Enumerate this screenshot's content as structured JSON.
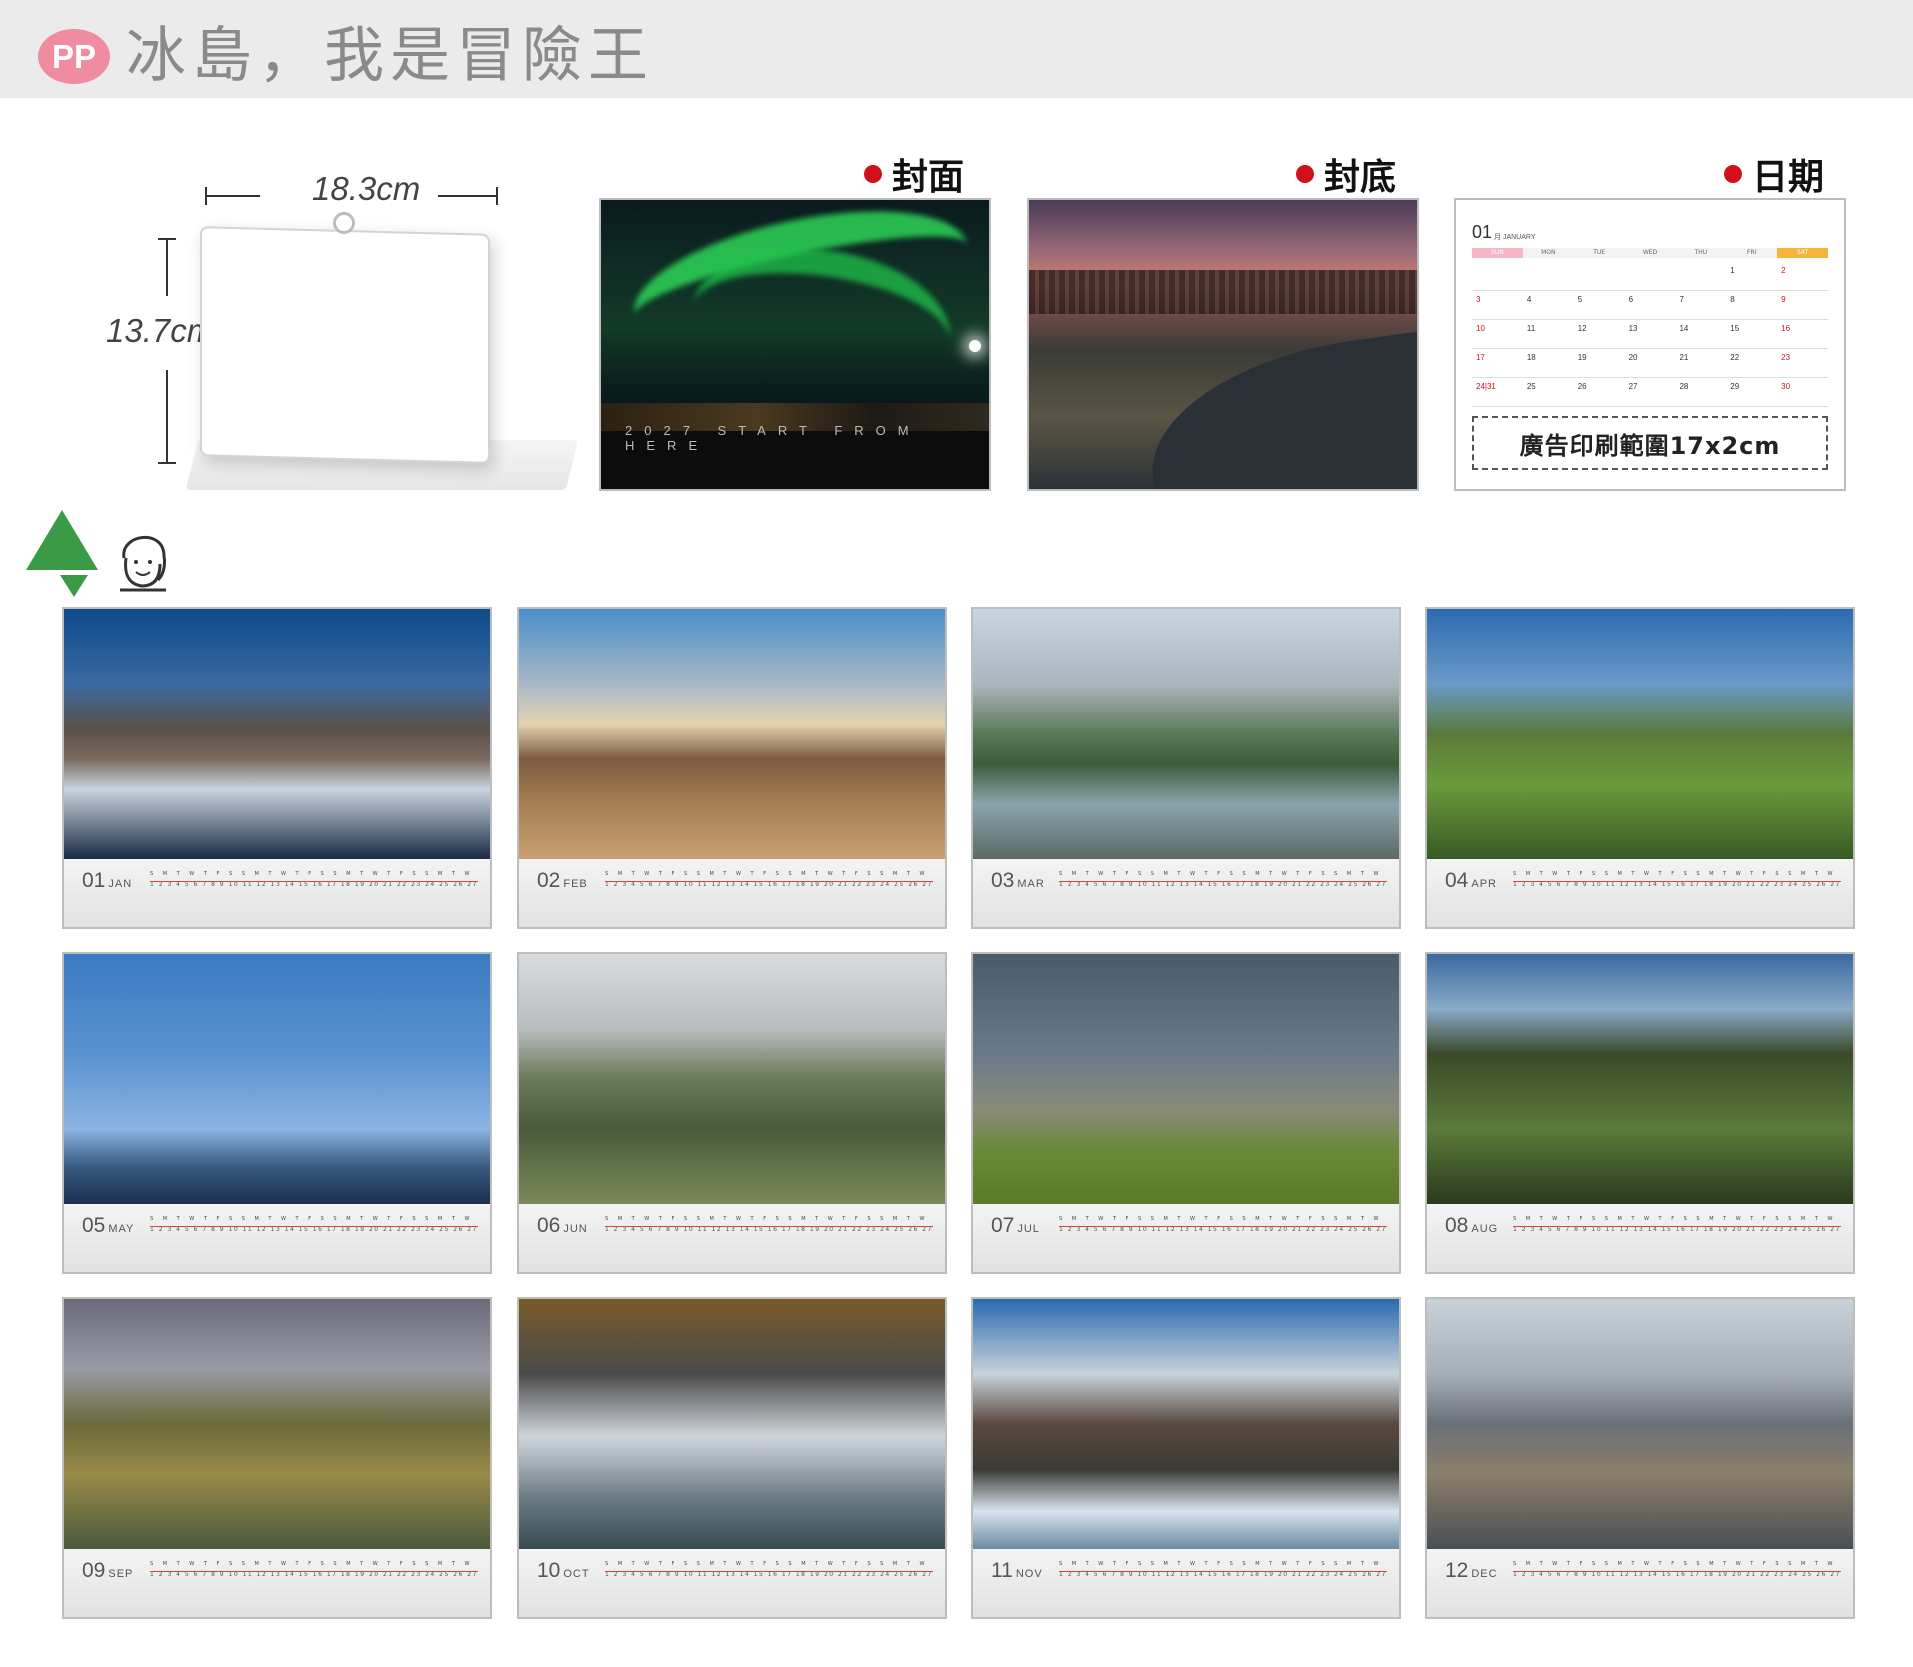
{
  "header": {
    "logo": "PP",
    "title": "冰島，我是冒險王"
  },
  "diagram": {
    "width_label": "18.3cm",
    "height_label": "13.7cm"
  },
  "panels": {
    "front": {
      "label": "封面",
      "cover_text": "2027  START  FROM  HERE"
    },
    "back": {
      "label": "封底"
    },
    "date": {
      "label": "日期",
      "month_num": "01",
      "month_name": "月 JANUARY",
      "weekdays": [
        "SUN",
        "MON",
        "TUE",
        "WED",
        "THU",
        "FRI",
        "SAT"
      ],
      "weeks": [
        [
          "",
          "",
          "",
          "",
          "",
          "1",
          "2"
        ],
        [
          "3",
          "4",
          "5",
          "6",
          "7",
          "8",
          "9"
        ],
        [
          "10",
          "11",
          "12",
          "13",
          "14",
          "15",
          "16"
        ],
        [
          "17",
          "18",
          "19",
          "20",
          "21",
          "22",
          "23"
        ],
        [
          "24|31",
          "25",
          "26",
          "27",
          "28",
          "29",
          "30"
        ]
      ],
      "ad_text": "廣告印刷範圍17x2cm"
    }
  },
  "months": [
    {
      "num": "01",
      "name": "JAN"
    },
    {
      "num": "02",
      "name": "FEB"
    },
    {
      "num": "03",
      "name": "MAR"
    },
    {
      "num": "04",
      "name": "APR"
    },
    {
      "num": "05",
      "name": "MAY"
    },
    {
      "num": "06",
      "name": "JUN"
    },
    {
      "num": "07",
      "name": "JUL"
    },
    {
      "num": "08",
      "name": "AUG"
    },
    {
      "num": "09",
      "name": "SEP"
    },
    {
      "num": "10",
      "name": "OCT"
    },
    {
      "num": "11",
      "name": "NOV"
    },
    {
      "num": "12",
      "name": "DEC"
    }
  ],
  "strip_dow": "S M T W T F S S M T W T F S S M T W T F S S M T W T F S S M T W T F S",
  "strip_days": "1 2 3 4 5 6 7 8 9 10 11 12 13 14 15 16 17 18 19 20 21 22 23 24 25 26 27 28 29 30 31",
  "colors": {
    "accent_red": "#d0101b",
    "logo_pink": "#f08ca0",
    "tree_green": "#3a9a46"
  }
}
